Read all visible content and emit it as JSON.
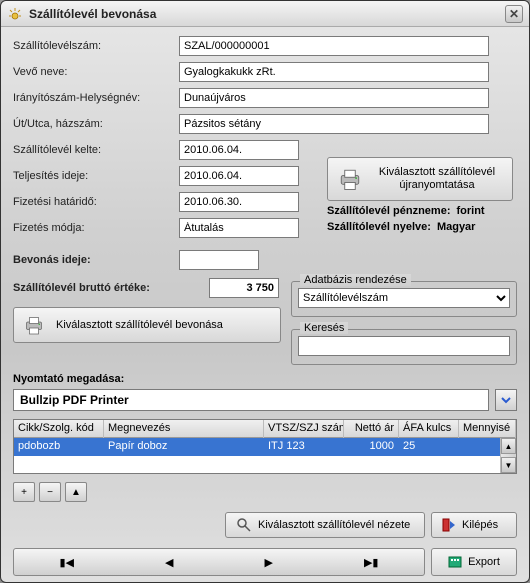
{
  "window": {
    "title": "Szállítólevél bevonása"
  },
  "fields": {
    "deliveryNoteNumber": {
      "label": "Szállítólevélszám:",
      "value": "SZAL/000000001"
    },
    "buyerName": {
      "label": "Vevő neve:",
      "value": "Gyalogkakukk zRt."
    },
    "cityZip": {
      "label": "Irányítószám-Helységnév:",
      "value": "Dunaújváros"
    },
    "street": {
      "label": "Út/Utca, házszám:",
      "value": "Pázsitos sétány"
    },
    "deliveryDate": {
      "label": "Szállítólevél kelte:",
      "value": "2010.06.04."
    },
    "fulfillmentDate": {
      "label": "Teljesítés ideje:",
      "value": "2010.06.04."
    },
    "paymentDeadline": {
      "label": "Fizetési határidő:",
      "value": "2010.06.30."
    },
    "paymentMethod": {
      "label": "Fizetés módja:",
      "value": "Átutalás"
    },
    "includeTime": {
      "label": "Bevonás ideje:",
      "value": ""
    },
    "grossValue": {
      "label": "Szállítólevél bruttó értéke:",
      "value": "3 750"
    }
  },
  "sidebar": {
    "reprint": "Kiválasztott szállítólevél újranyomtatása",
    "currencyLabel": "Szállítólevél pénzneme:",
    "currencyValue": "forint",
    "langLabel": "Szállítólevél nyelve:",
    "langValue": "Magyar"
  },
  "groups": {
    "dbOrder": {
      "legend": "Adatbázis rendezése",
      "value": "Szállítólevélszám"
    },
    "search": {
      "legend": "Keresés",
      "value": ""
    }
  },
  "includeBtn": "Kiválasztott szállítólevél bevonása",
  "printerCaption": "Nyomtató megadása:",
  "printerName": "Bullzip PDF Printer",
  "table": {
    "headers": [
      "Cikk/Szolg. kód",
      "Megnevezés",
      "VTSZ/SZJ szám",
      "Nettó ár",
      "ÁFA kulcs",
      "Mennyisé"
    ],
    "rows": [
      {
        "code": "pdobozb",
        "name": "Papír doboz",
        "vtsz": "ITJ 123",
        "net": "1000",
        "vat": "25",
        "qty": ""
      }
    ]
  },
  "buttons": {
    "view": "Kiválasztott szállítólevél nézete",
    "exit": "Kilépés",
    "export": "Export"
  }
}
